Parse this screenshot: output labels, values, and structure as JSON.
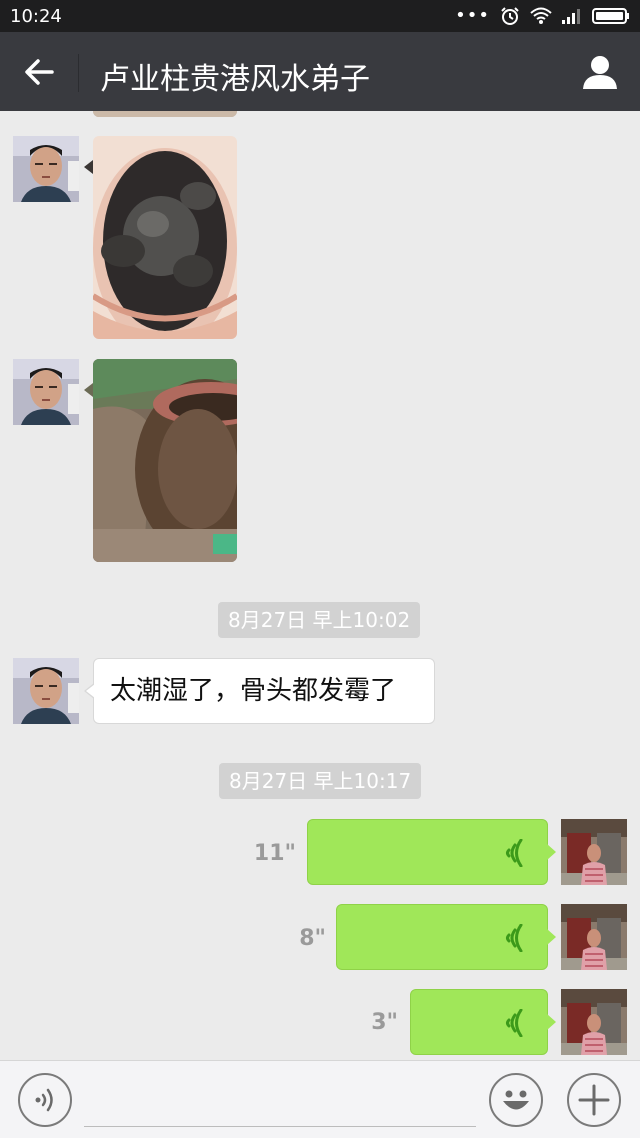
{
  "status_bar": {
    "time": "10:24",
    "icons": [
      "more-dots-icon",
      "alarm-icon",
      "wifi-icon",
      "signal-icon",
      "battery-icon"
    ]
  },
  "header": {
    "title": "卢业柱贵港风水弟子",
    "back_icon": "back-arrow-icon",
    "profile_icon": "person-icon"
  },
  "messages": [
    {
      "type": "image",
      "sender": "contact",
      "content": "pottery jar with charred contents"
    },
    {
      "type": "image",
      "sender": "contact",
      "content": "brown clay jar in soil"
    },
    {
      "type": "timestamp",
      "text": "8月27日 早上10:02"
    },
    {
      "type": "text",
      "sender": "contact",
      "text": "太潮湿了，骨头都发霉了"
    },
    {
      "type": "timestamp",
      "text": "8月27日 早上10:17"
    },
    {
      "type": "voice",
      "sender": "me",
      "duration": "11\""
    },
    {
      "type": "voice",
      "sender": "me",
      "duration": "8\""
    },
    {
      "type": "voice",
      "sender": "me",
      "duration": "3\""
    }
  ],
  "colors": {
    "title_bar": "#393a3f",
    "status_bar": "#1e1e1f",
    "chat_background": "#ebebeb",
    "voice_bubble": "#a0e759",
    "voice_wave": "#3c9a1a"
  },
  "input_bar": {
    "voice_toggle_icon": "voice-mode-icon",
    "emoji_icon": "smiley-icon",
    "plus_icon": "plus-icon",
    "placeholder": ""
  }
}
